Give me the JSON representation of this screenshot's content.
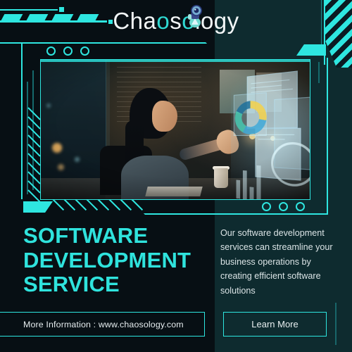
{
  "brand": {
    "name": "Chaosology",
    "name_parts": [
      {
        "text": "Cha",
        "color": "#f2f6f7"
      },
      {
        "text": "o",
        "color": "#2fd9d2"
      },
      {
        "text": "s",
        "color": "#f2f6f7"
      },
      {
        "text": "o",
        "color": "#2fd9d2"
      },
      {
        "text": "l",
        "color": "#f2f6f7"
      },
      {
        "text": "o",
        "color": "#f2f6f7"
      },
      {
        "text": "gy",
        "color": "#f2f6f7"
      }
    ],
    "mascot_icon": "astronaut-robot-icon"
  },
  "hero": {
    "image_alt": "woman at desk interacting with holographic data dashboard",
    "window_dots_count": 3
  },
  "headline": {
    "line1": "SOFTWARE",
    "line2": "DEVELOPMENT",
    "line3": "SERVICE"
  },
  "body": {
    "paragraph": "Our software development services can streamline your business operations by creating efficient software solutions"
  },
  "footer": {
    "info_label": "More Information : www.chaosology.com",
    "cta_label": "Learn More"
  },
  "colors": {
    "accent": "#2ee6e0",
    "headline": "#2fe3dd",
    "bg_left": "#070f14",
    "bg_right": "#0e2b2f",
    "text_light": "#dbe4e6"
  }
}
